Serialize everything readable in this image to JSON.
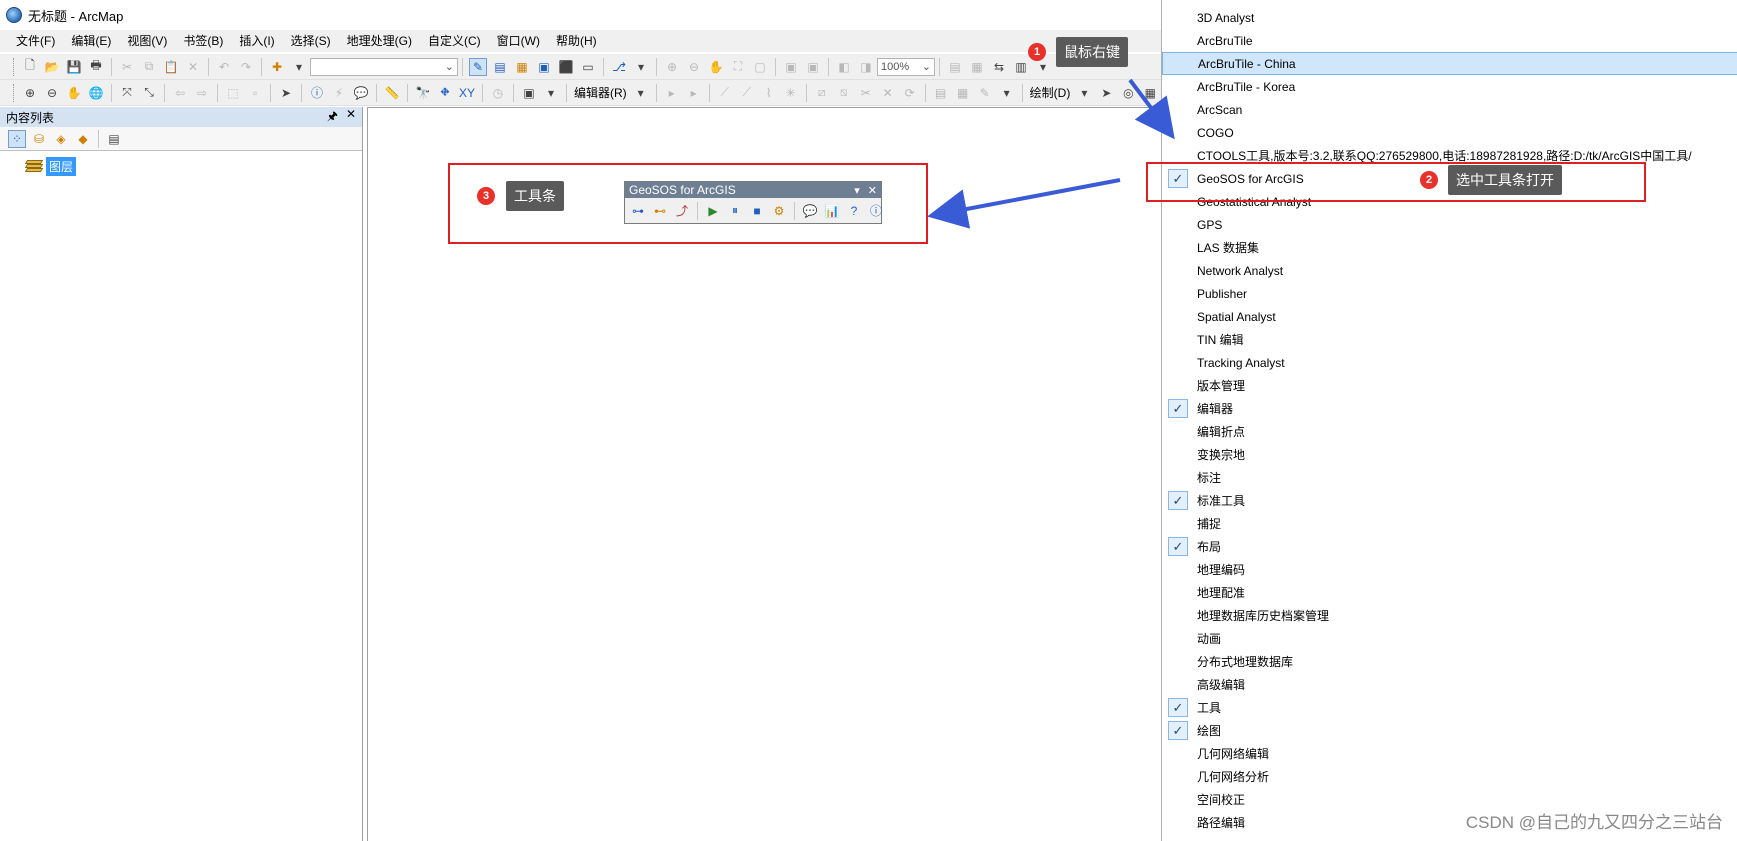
{
  "window": {
    "title": "无标题 - ArcMap"
  },
  "menubar": [
    "文件(F)",
    "编辑(E)",
    "视图(V)",
    "书签(B)",
    "插入(I)",
    "选择(S)",
    "地理处理(G)",
    "自定义(C)",
    "窗口(W)",
    "帮助(H)"
  ],
  "toolbar1": {
    "scale_value": "",
    "zoom_value": "100%"
  },
  "toolbar2": {
    "editor_label": "编辑器(R)",
    "draw_label": "绘制(D)"
  },
  "toc": {
    "title": "内容列表",
    "layer_label": "图层"
  },
  "geosos_toolbar": {
    "title": "GeoSOS for ArcGIS"
  },
  "annotations": {
    "step1": {
      "number": "1",
      "text": "鼠标右键"
    },
    "step2": {
      "number": "2",
      "text": "选中工具条打开"
    },
    "step3": {
      "number": "3",
      "text": "工具条"
    },
    "color_box": "#e02020",
    "color_arrow": "#3a5bd6"
  },
  "context_menu": {
    "items": [
      {
        "label": "3D Analyst",
        "checked": false
      },
      {
        "label": "ArcBruTile",
        "checked": false
      },
      {
        "label": "ArcBruTile - China",
        "checked": false,
        "highlighted": true
      },
      {
        "label": "ArcBruTile - Korea",
        "checked": false
      },
      {
        "label": "ArcScan",
        "checked": false
      },
      {
        "label": "COGO",
        "checked": false
      },
      {
        "label": "CTOOLS工具,版本号:3.2,联系QQ:276529800,电话:18987281928,路径:D:/tk/ArcGIS中国工具/",
        "checked": false
      },
      {
        "label": "GeoSOS for ArcGIS",
        "checked": true
      },
      {
        "label": "Geostatistical Analyst",
        "checked": false
      },
      {
        "label": "GPS",
        "checked": false
      },
      {
        "label": "LAS 数据集",
        "checked": false
      },
      {
        "label": "Network Analyst",
        "checked": false
      },
      {
        "label": "Publisher",
        "checked": false
      },
      {
        "label": "Spatial Analyst",
        "checked": false
      },
      {
        "label": "TIN 编辑",
        "checked": false
      },
      {
        "label": "Tracking Analyst",
        "checked": false
      },
      {
        "label": "版本管理",
        "checked": false
      },
      {
        "label": "编辑器",
        "checked": true
      },
      {
        "label": "编辑折点",
        "checked": false
      },
      {
        "label": "变换宗地",
        "checked": false
      },
      {
        "label": "标注",
        "checked": false
      },
      {
        "label": "标准工具",
        "checked": true
      },
      {
        "label": "捕捉",
        "checked": false
      },
      {
        "label": "布局",
        "checked": true
      },
      {
        "label": "地理编码",
        "checked": false
      },
      {
        "label": "地理配准",
        "checked": false
      },
      {
        "label": "地理数据库历史档案管理",
        "checked": false
      },
      {
        "label": "动画",
        "checked": false
      },
      {
        "label": "分布式地理数据库",
        "checked": false
      },
      {
        "label": "高级编辑",
        "checked": false
      },
      {
        "label": "工具",
        "checked": true
      },
      {
        "label": "绘图",
        "checked": true
      },
      {
        "label": "几何网络编辑",
        "checked": false
      },
      {
        "label": "几何网络分析",
        "checked": false
      },
      {
        "label": "空间校正",
        "checked": false
      },
      {
        "label": "路径编辑",
        "checked": false
      }
    ]
  },
  "watermark": "CSDN @自己的九又四分之三站台"
}
